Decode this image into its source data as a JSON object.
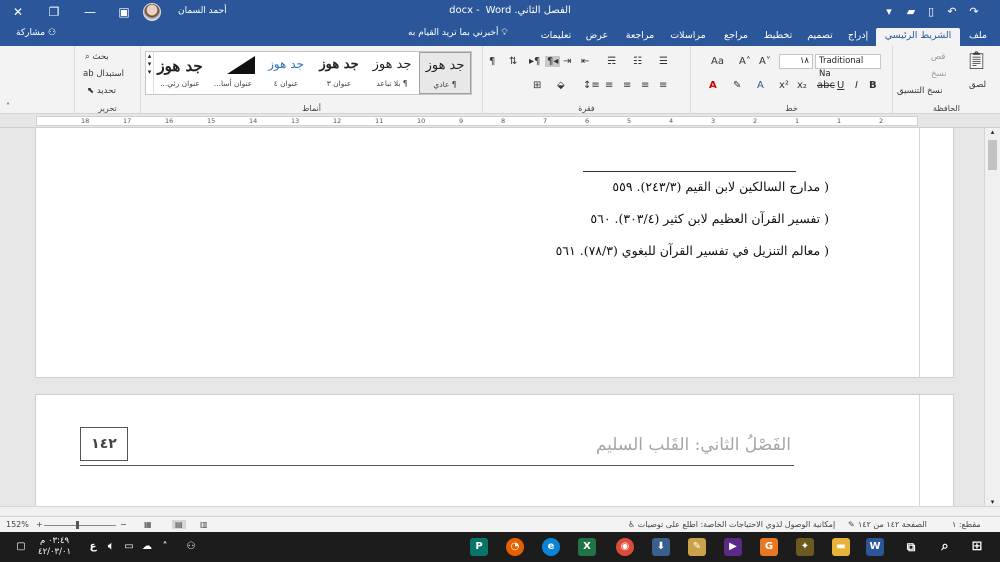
{
  "titlebar": {
    "doc_name": "الفصل الثاني.docx",
    "separator": "-",
    "app_name": "Word",
    "user_name": "أحمد السمان"
  },
  "tabs": [
    {
      "label": "ملف"
    },
    {
      "label": "الشريط الرئيسي",
      "active": true
    },
    {
      "label": "إدراج"
    },
    {
      "label": "تصميم"
    },
    {
      "label": "تخطيط"
    },
    {
      "label": "مراجع"
    },
    {
      "label": "مراسلات"
    },
    {
      "label": "مراجعة"
    },
    {
      "label": "عرض"
    },
    {
      "label": "تعليمات"
    }
  ],
  "tellme": "أخبرني بما تريد القيام به",
  "share": "مشاركة",
  "ribbon": {
    "clipboard": {
      "label": "الحافظة",
      "paste": "لصق",
      "cut": "قص",
      "copy": "نسخ",
      "format_painter": "نسخ التنسيق"
    },
    "font": {
      "label": "خط",
      "font_name": "Traditional Na",
      "font_size": "١٨"
    },
    "paragraph": {
      "label": "فقرة"
    },
    "styles": {
      "label": "أنماط",
      "items": [
        {
          "sample": "جد هوز",
          "name": "¶ عادي"
        },
        {
          "sample": "جد هوز",
          "name": "¶ بلا تباعد"
        },
        {
          "sample": "جد هوز",
          "name": "عنوان ٣"
        },
        {
          "sample": "جد هوز",
          "name": "عنوان ٤"
        },
        {
          "sample": "",
          "name": "عنوان أسا..."
        },
        {
          "sample": "جد هوز",
          "name": "عنوان رئي..."
        }
      ]
    },
    "editing": {
      "label": "تحرير",
      "find": "بحث",
      "replace": "استبدال",
      "select": "تحديد"
    }
  },
  "ruler": {
    "numbers": [
      "2",
      "1",
      "1",
      "2",
      "3",
      "4",
      "5",
      "6",
      "7",
      "8",
      "9",
      "10",
      "11",
      "12",
      "13",
      "14",
      "15",
      "16",
      "17",
      "18"
    ]
  },
  "document": {
    "footnotes": [
      "( مدارج السالكين لابن القيم (٢٤٣/٣). ٥٥٩",
      "( تفسير القرآن العظيم لابن كثير (٣٠٣/٤). ٥٦٠",
      "( معالم التنزيل في تفسير القرآن للبغوي (٧٨/٣). ٥٦١"
    ],
    "header_title": "الفَصْلُ الثاني: القَلب السليم",
    "page_number": "١٤٢"
  },
  "statusbar": {
    "page_info": "الصفحة ١٤٢ من ١٤٢",
    "section": "مقطع: ١",
    "accessibility": "إمكانية الوصول لذوي الاحتياجات الخاصة: اطلع على توصيات",
    "zoom": "152%"
  },
  "taskbar": {
    "time": "٠٣:٤٩ م",
    "date": "٤٢/٠٣/٠١"
  },
  "colors": {
    "accent": "#2b579a",
    "header_text": "#a6a6a6"
  }
}
